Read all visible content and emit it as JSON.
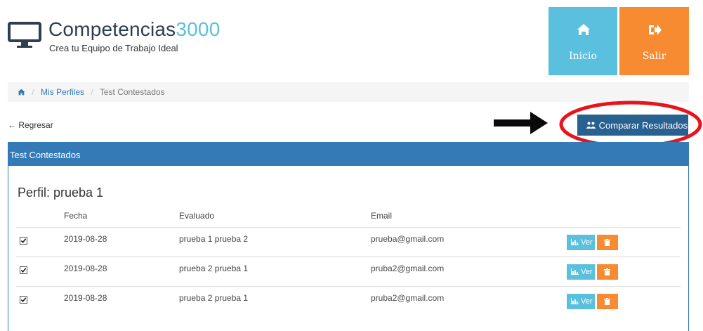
{
  "brand": {
    "title_main": "Competencias",
    "title_num": "3000",
    "subtitle": "Crea tu Equipo de Trabajo Ideal"
  },
  "nav": {
    "home_label": "Inicio",
    "exit_label": "Salir"
  },
  "breadcrumb": {
    "home_icon": "home-icon",
    "level1": "Mis Perfiles",
    "current": "Test Contestados"
  },
  "toolbar": {
    "back_label": "Regresar",
    "compare_label": "Comparar Resultados"
  },
  "panel": {
    "title": "Test Contestados",
    "profile_label": "Perfil: prueba 1"
  },
  "table": {
    "headers": {
      "date": "Fecha",
      "evaluated": "Evaluado",
      "email": "Email"
    },
    "rows": [
      {
        "checked": true,
        "date": "2019-08-28",
        "evaluated": "prueba 1 prueba 2",
        "email": "prueba@gmail.com",
        "view_label": "Ver"
      },
      {
        "checked": true,
        "date": "2019-08-28",
        "evaluated": "prueba 2 prueba 1",
        "email": "pruba2@gmail.com",
        "view_label": "Ver"
      },
      {
        "checked": true,
        "date": "2019-08-28",
        "evaluated": "prueba 2 prueba 1",
        "email": "pruba2@gmail.com",
        "view_label": "Ver"
      }
    ]
  },
  "colors": {
    "primary": "#337ab7",
    "info": "#5bc0de",
    "warning": "#f68b32",
    "dark_button": "#286090",
    "annotation": "#e8141c"
  }
}
